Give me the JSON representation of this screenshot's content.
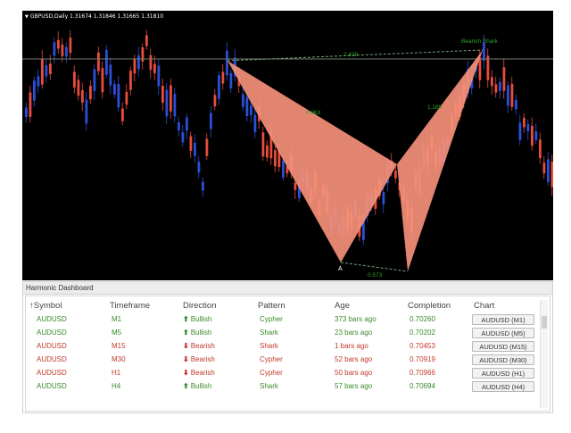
{
  "chart": {
    "title": "GBPUSD,Daily  1.31674 1.31846 1.31665 1.31810",
    "pattern_label": "Bearish Shark",
    "ratio_top": "2.438",
    "ratio_left": "0.963",
    "ratio_right": "1.289",
    "ratio_bottom": "0.573",
    "point_a_label": "A",
    "colors": {
      "bull": "#2b4fd8",
      "bear": "#e84c3d",
      "pattern_fill": "#f5907a",
      "hline": "#6f7f6f",
      "label_green": "#2fa52f"
    }
  },
  "dashboard": {
    "title": "Harmonic Dashboard",
    "sort_icon": "↑",
    "headers": [
      "Symbol",
      "Timeframe",
      "Direction",
      "Pattern",
      "Age",
      "Completion",
      "Chart"
    ],
    "rows": [
      {
        "symbol": "AUDUSD",
        "timeframe": "M1",
        "direction": "Bullish",
        "dir": "up",
        "pattern": "Cypher",
        "age": "373 bars ago",
        "completion": "0.70260",
        "chart": "AUDUSD (M1)"
      },
      {
        "symbol": "AUDUSD",
        "timeframe": "M5",
        "direction": "Bullish",
        "dir": "up",
        "pattern": "Shark",
        "age": "23 bars ago",
        "completion": "0.70202",
        "chart": "AUDUSD (M5)"
      },
      {
        "symbol": "AUDUSD",
        "timeframe": "M15",
        "direction": "Bearish",
        "dir": "down",
        "pattern": "Shark",
        "age": "1 bars ago",
        "completion": "0.70453",
        "chart": "AUDUSD (M15)"
      },
      {
        "symbol": "AUDUSD",
        "timeframe": "M30",
        "direction": "Bearish",
        "dir": "down",
        "pattern": "Cypher",
        "age": "52 bars ago",
        "completion": "0.70919",
        "chart": "AUDUSD (M30)"
      },
      {
        "symbol": "AUDUSD",
        "timeframe": "H1",
        "direction": "Bearish",
        "dir": "down",
        "pattern": "Cypher",
        "age": "50 bars ago",
        "completion": "0.70966",
        "chart": "AUDUSD (H1)"
      },
      {
        "symbol": "AUDUSD",
        "timeframe": "H4",
        "direction": "Bullish",
        "dir": "up",
        "pattern": "Shark",
        "age": "57 bars ago",
        "completion": "0.70694",
        "chart": "AUDUSD (H4)"
      }
    ]
  }
}
